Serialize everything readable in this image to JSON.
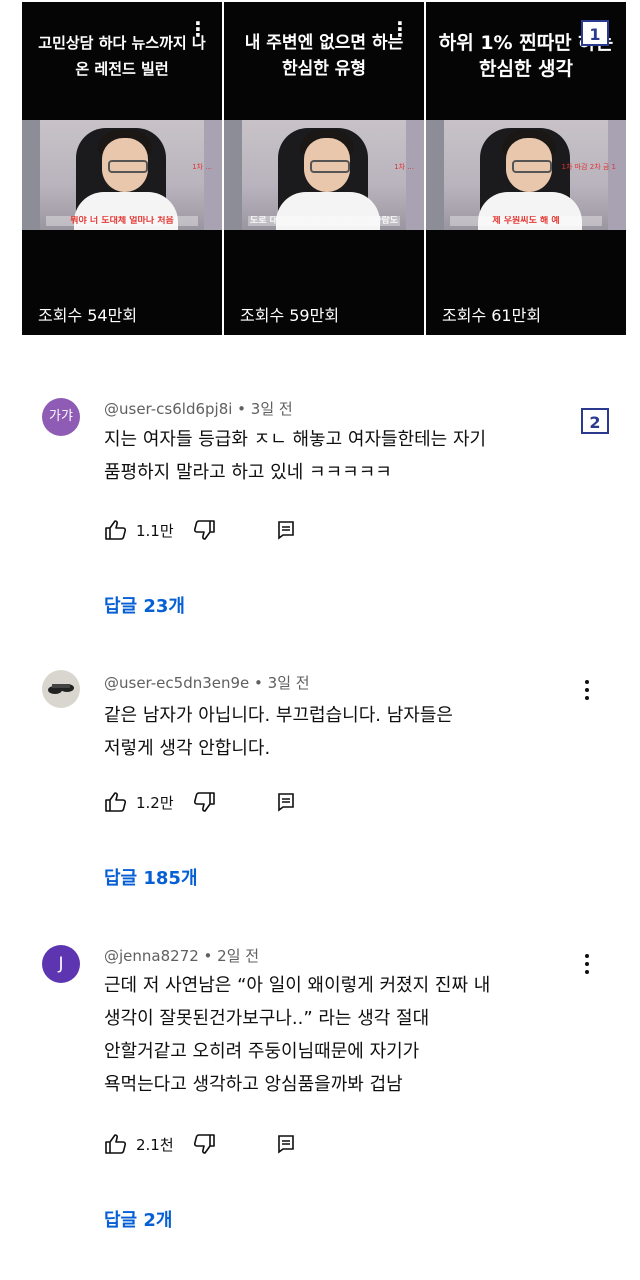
{
  "shorts": [
    {
      "title": "고민상담 하다 뉴스까지 나온 레전드 빌런",
      "subtitle": "뭐야 너 도대체 얼마나 처음",
      "side_caption": "1차 ...",
      "views": "조회수 54만회"
    },
    {
      "title": "내 주변엔 없으면 하는 한심한 유형",
      "subtitle": "도로 대에서서 한 번에 끝내버린 사람도 있어",
      "side_caption": "1차 ...",
      "views": "조회수 59만회"
    },
    {
      "title": "하위 1% 찐따만 하는 한심한 생각",
      "subtitle": "제 우원씨도 해 예",
      "side_caption": "1차 마감 2차 금 1",
      "views": "조회수 61만회"
    }
  ],
  "markers": [
    "1",
    "2"
  ],
  "comments": [
    {
      "avatar_text": "가갸",
      "avatar_color": "#8e5bb5",
      "meta": "@user-cs6ld6pj8i • 3일 전",
      "lines": [
        "지는 여자들 등급화 ㅈㄴ 해놓고 여자들한테는 자기",
        "품평하지 말라고 하고 있네 ㅋㅋㅋㅋㅋ"
      ],
      "likes": "1.1만",
      "replies": "답글 23개"
    },
    {
      "avatar_text": "",
      "avatar_color": "#d9d6cf",
      "meta": "@user-ec5dn3en9e • 3일 전",
      "lines": [
        "같은 남자가 아닙니다. 부끄럽습니다. 남자들은",
        "저렇게 생각 안합니다."
      ],
      "likes": "1.2만",
      "replies": "답글 185개"
    },
    {
      "avatar_text": "J",
      "avatar_color": "#5e35b1",
      "meta": "@jenna8272 • 2일 전",
      "lines": [
        "근데 저 사연남은 “아 일이 왜이렇게 커졌지 진짜 내",
        "생각이 잘못된건가보구나..” 라는 생각 절대",
        "안할거같고 오히려 주둥이님때문에 자기가",
        "욕먹는다고 생각하고 앙심품을까봐 겁남"
      ],
      "likes": "2.1천",
      "replies": "답글 2개"
    }
  ],
  "icons": {
    "like": "thumbs-up-icon",
    "dislike": "thumbs-down-icon",
    "reply": "comment-icon",
    "more": "more-vert-icon"
  },
  "colors": {
    "link": "#065fd4",
    "marker": "#2a3a8e",
    "card_bg": "#050505"
  }
}
